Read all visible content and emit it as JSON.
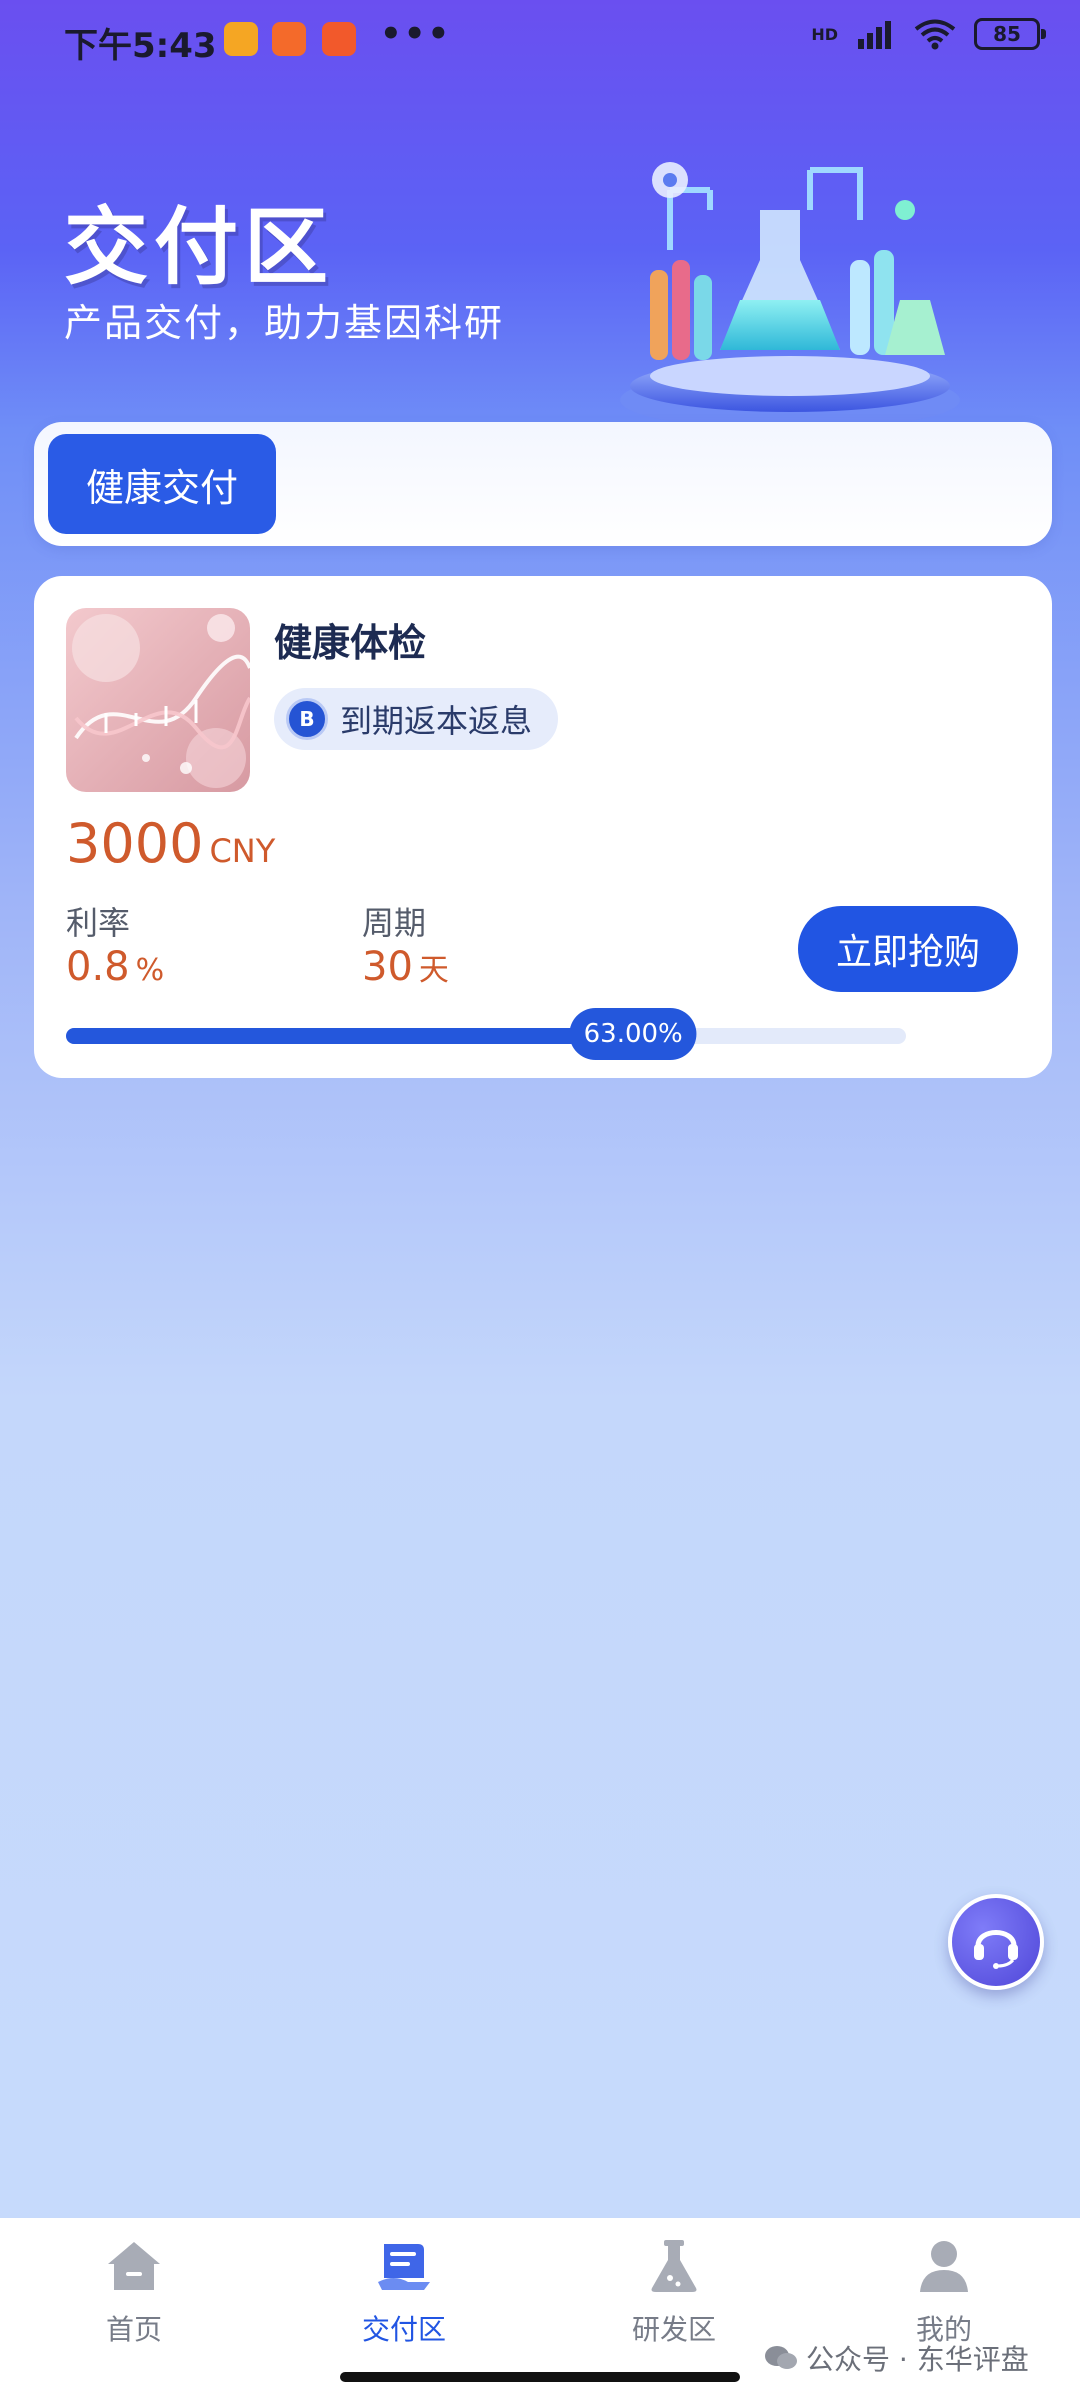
{
  "status_bar": {
    "time": "下午5:43",
    "dots": "•••",
    "network": "HD",
    "battery": "85"
  },
  "header": {
    "title": "交付区",
    "subtitle": "产品交付，助力基因科研"
  },
  "tabs": [
    {
      "label": "健康交付",
      "active": true
    }
  ],
  "product": {
    "name": "健康体检",
    "tag": "到期返本返息",
    "tag_icon_letter": "B",
    "price": "3000",
    "currency": "CNY",
    "rate_label": "利率",
    "rate_value": "0.8",
    "rate_unit": "%",
    "period_label": "周期",
    "period_value": "30",
    "period_unit": "天",
    "buy_label": "立即抢购",
    "progress_text": "63.00%",
    "progress": 0.63
  },
  "bottom_nav": [
    {
      "label": "首页",
      "icon": "home-icon",
      "active": false
    },
    {
      "label": "交付区",
      "icon": "delivery-icon",
      "active": true
    },
    {
      "label": "研发区",
      "icon": "flask-icon",
      "active": false
    },
    {
      "label": "我的",
      "icon": "person-icon",
      "active": false
    }
  ],
  "watermark": "公众号 · 东华评盘",
  "colors": {
    "accent": "#2155e3",
    "price": "#cf5a2c"
  }
}
